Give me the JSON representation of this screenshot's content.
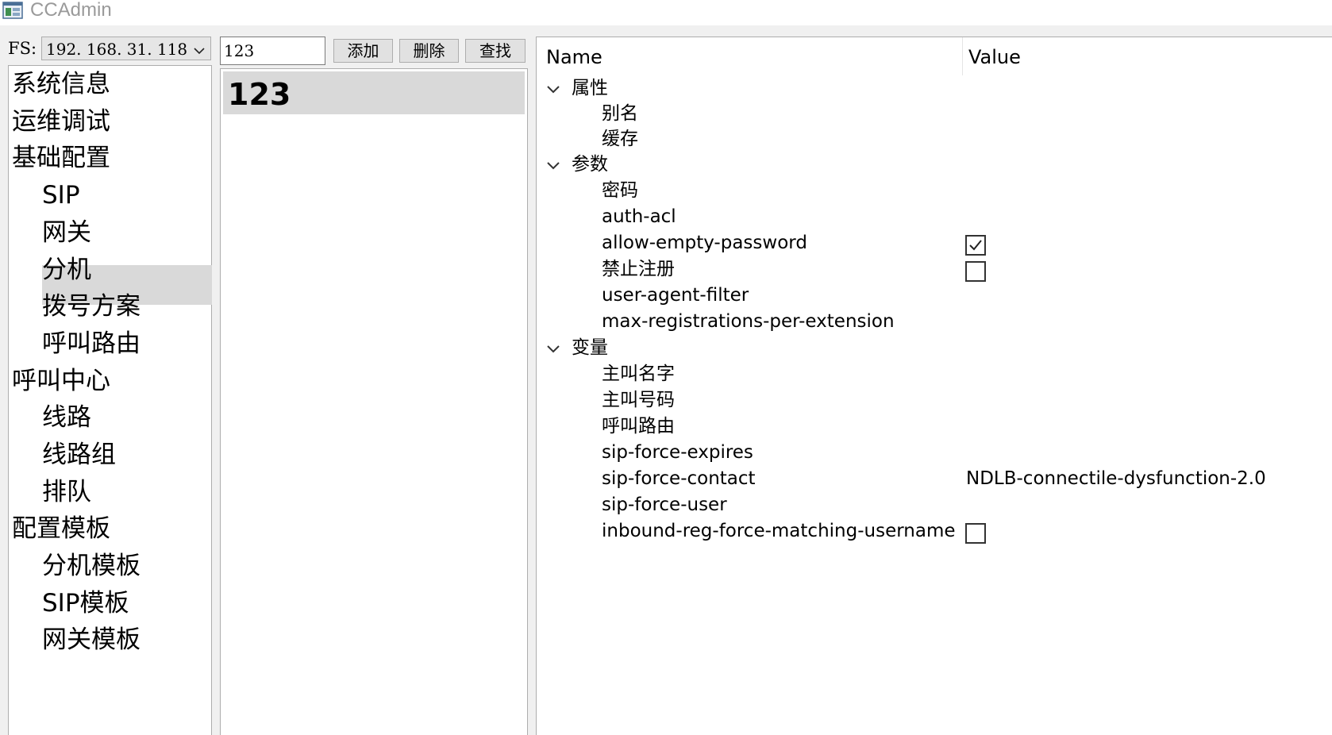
{
  "window": {
    "title": "CCAdmin"
  },
  "fs": {
    "label": "FS:",
    "selected": "192. 168. 31. 118:"
  },
  "nav": {
    "items": [
      {
        "label": "系统信息",
        "level": 0
      },
      {
        "label": "运维调试",
        "level": 0
      },
      {
        "label": "基础配置",
        "level": 0
      },
      {
        "label": "SIP",
        "level": 1
      },
      {
        "label": "网关",
        "level": 1
      },
      {
        "label": "分机",
        "level": 1,
        "selected": true
      },
      {
        "label": "拨号方案",
        "level": 1
      },
      {
        "label": "呼叫路由",
        "level": 1
      },
      {
        "label": "呼叫中心",
        "level": 0
      },
      {
        "label": "线路",
        "level": 1
      },
      {
        "label": "线路组",
        "level": 1
      },
      {
        "label": "排队",
        "level": 1
      },
      {
        "label": "配置模板",
        "level": 0
      },
      {
        "label": "分机模板",
        "level": 1
      },
      {
        "label": "SIP模板",
        "level": 1
      },
      {
        "label": "网关模板",
        "level": 1
      }
    ]
  },
  "toolbar": {
    "search_value": "123",
    "add_label": "添加",
    "delete_label": "删除",
    "find_label": "查找"
  },
  "list": {
    "items": [
      "123"
    ]
  },
  "properties": {
    "headers": {
      "name": "Name",
      "value": "Value"
    },
    "groups": [
      {
        "name": "属性",
        "expanded": true,
        "items": [
          {
            "name": "别名",
            "value": ""
          },
          {
            "name": "缓存",
            "value": ""
          }
        ]
      },
      {
        "name": "参数",
        "expanded": true,
        "items": [
          {
            "name": "密码",
            "value": ""
          },
          {
            "name": "auth-acl",
            "value": ""
          },
          {
            "name": "allow-empty-password",
            "checkbox": true,
            "checked": true
          },
          {
            "name": "禁止注册",
            "checkbox": true,
            "checked": false
          },
          {
            "name": "user-agent-filter",
            "value": ""
          },
          {
            "name": "max-registrations-per-extension",
            "value": ""
          }
        ]
      },
      {
        "name": "变量",
        "expanded": true,
        "items": [
          {
            "name": "主叫名字",
            "value": ""
          },
          {
            "name": "主叫号码",
            "value": ""
          },
          {
            "name": "呼叫路由",
            "value": ""
          },
          {
            "name": "sip-force-expires",
            "value": ""
          },
          {
            "name": "sip-force-contact",
            "value": "NDLB-connectile-dysfunction-2.0"
          },
          {
            "name": "sip-force-user",
            "value": ""
          },
          {
            "name": "inbound-reg-force-matching-username",
            "checkbox": true,
            "checked": false
          }
        ]
      }
    ]
  },
  "colors": {
    "selection": "#d9d9d9",
    "chrome": "#f0f0f0",
    "border": "#adadad"
  }
}
